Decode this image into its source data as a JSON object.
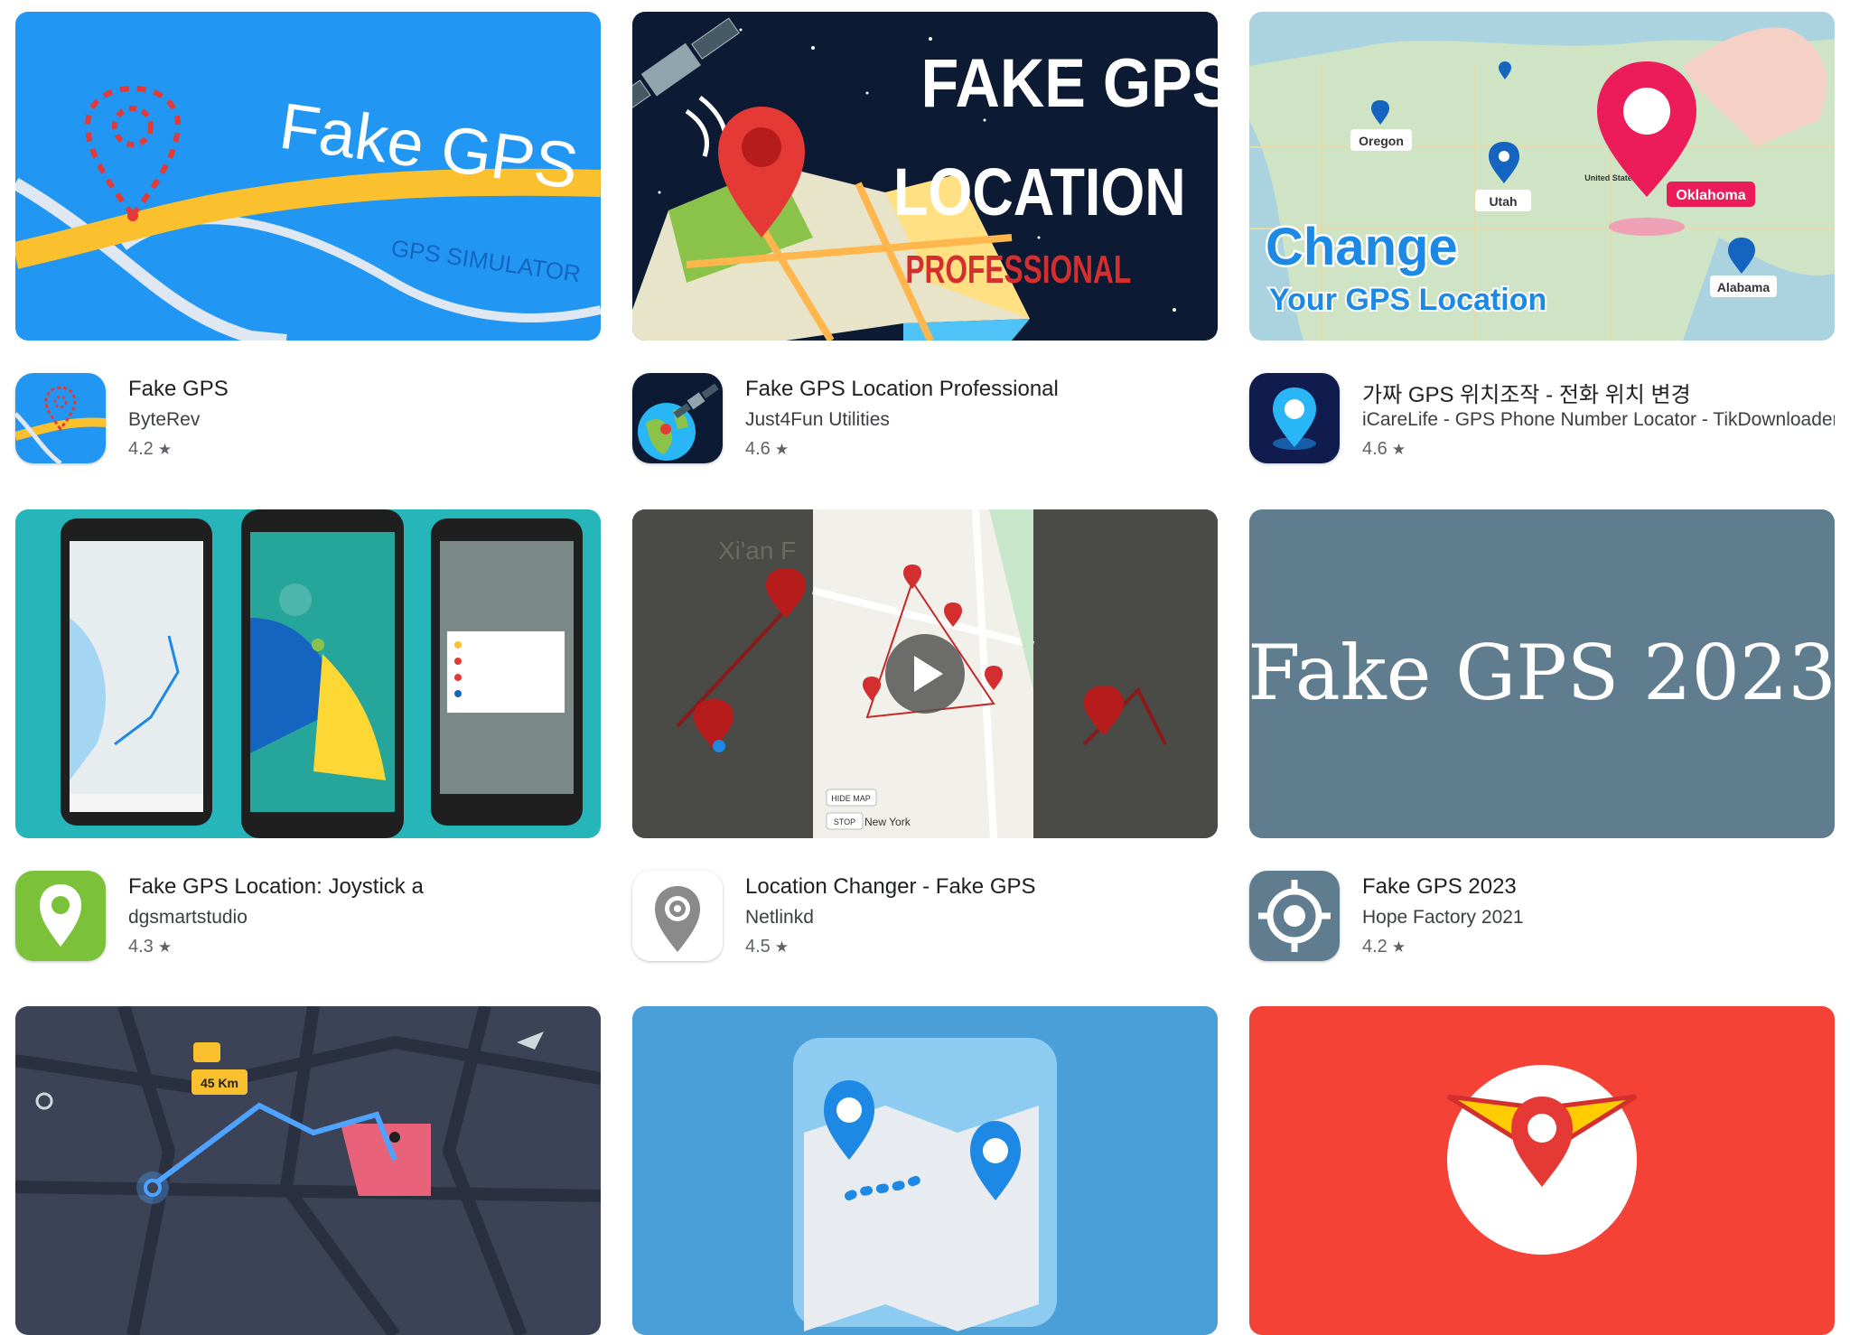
{
  "apps": [
    {
      "name": "Fake GPS",
      "developer": "ByteRev",
      "rating": "4.2",
      "banner_title": "Fake GPS",
      "banner_subtitle": "GPS SIMULATOR",
      "banner_color": "#2196f3"
    },
    {
      "name": "Fake GPS Location Professional",
      "developer": "Just4Fun Utilities",
      "rating": "4.6",
      "banner_line1": "FAKE GPS",
      "banner_line2": "LOCATION",
      "banner_line3": "PROFESSIONAL",
      "banner_color": "#0d1a33"
    },
    {
      "name": "가짜 GPS 위치조작 - 전화 위치 변경",
      "developer": "iCareLife - GPS Phone Number Locator - TikDownloader",
      "rating": "4.6",
      "banner_line1": "Change",
      "banner_line2": "Your GPS Location",
      "labels": [
        "Oregon",
        "Utah",
        "United States",
        "Oklahoma",
        "Alabama"
      ],
      "banner_color": "#cfe3c5"
    },
    {
      "name": "Fake GPS Location: Joystick a",
      "developer": "dgsmartstudio",
      "rating": "4.3",
      "banner_color": "#26b5b8"
    },
    {
      "name": "Location Changer - Fake GPS",
      "developer": "Netlinkd",
      "rating": "4.5",
      "map_labels": [
        "Xi'an F",
        "HIDE MAP",
        "STOP",
        "New York"
      ],
      "banner_color": "#3a3a3a"
    },
    {
      "name": "Fake GPS 2023",
      "developer": "Hope Factory 2021",
      "rating": "4.2",
      "banner_title": "Fake GPS 2023",
      "banner_color": "#5f7d8e"
    },
    {
      "name": "",
      "developer": "",
      "rating": "",
      "banner_label": "45 Km",
      "banner_color": "#3c4356"
    },
    {
      "name": "",
      "developer": "",
      "rating": "",
      "banner_color": "#4b9fd8"
    },
    {
      "name": "",
      "developer": "",
      "rating": "",
      "banner_color": "#f44336"
    }
  ],
  "star_glyph": "★"
}
